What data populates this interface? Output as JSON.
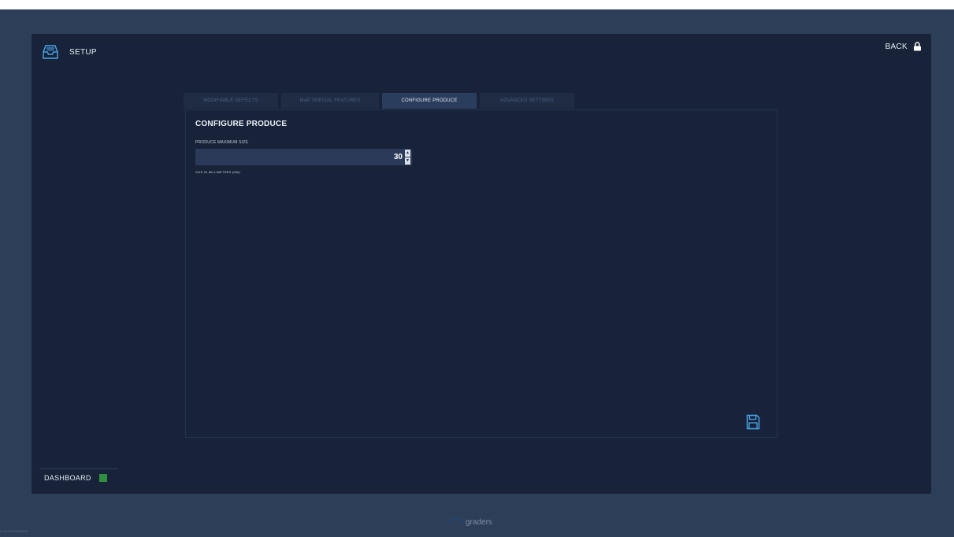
{
  "header": {
    "title": "SETUP",
    "back_label": "BACK"
  },
  "tabs": [
    {
      "label": "MODIFIABLE DEFECTS",
      "active": false
    },
    {
      "label": "MAP SPECIAL FEATURES",
      "active": false
    },
    {
      "label": "CONFIGURE PRODUCE",
      "active": true
    },
    {
      "label": "ADVANCED SETTINGS",
      "active": false
    }
  ],
  "panel": {
    "title": "CONFIGURE PRODUCE",
    "field_label": "PRODUCE MAXIMUM SIZE",
    "field_value": "30",
    "helper_text": "SIZE IN MILLIMETRES (MM)",
    "spinner_up": "▲",
    "spinner_down": "▼"
  },
  "sidebar": {
    "dashboard_label": "DASHBOARD"
  },
  "footer": {
    "brand": "graders",
    "version": "2.1.8 WORKSPACE"
  },
  "colors": {
    "background": "#2d3e58",
    "panel": "#18233a",
    "active_tab": "#2a3d5c",
    "accent_blue": "#4aa3e6",
    "status_green": "#2e8f3e"
  },
  "icons": [
    "inbox-tray-icon",
    "lock-icon",
    "save-disk-icon",
    "status-indicator-icon",
    "logo-mark-icon"
  ]
}
